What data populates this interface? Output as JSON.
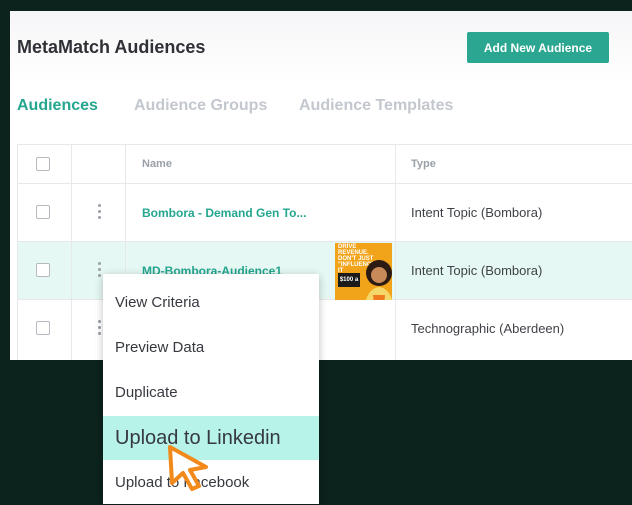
{
  "header": {
    "title": "MetaMatch Audiences",
    "add_button": "Add New Audience"
  },
  "tabs": [
    {
      "label": "Audiences",
      "active": true
    },
    {
      "label": "Audience Groups",
      "active": false
    },
    {
      "label": "Audience Templates",
      "active": false
    }
  ],
  "table": {
    "columns": [
      "Name",
      "Type"
    ],
    "rows": [
      {
        "name": "Bombora - Demand Gen To...",
        "type": "Intent Topic (Bombora)"
      },
      {
        "name": "MD-Bombora-Audience1",
        "type": "Intent Topic (Bombora)",
        "highlighted": true
      },
      {
        "name": "",
        "type": "Technographic (Aberdeen)"
      }
    ]
  },
  "context_menu": {
    "items": [
      {
        "label": "View Criteria"
      },
      {
        "label": "Preview Data"
      },
      {
        "label": "Duplicate"
      },
      {
        "label": "Upload to Linkedin",
        "highlighted": true
      },
      {
        "label": "Upload to Facebook"
      }
    ]
  },
  "ad_thumbnail": {
    "text": "DRIVE REVENUE. DON'T JUST \"INFLUENCE\" IT",
    "badge": "$100 a"
  },
  "colors": {
    "accent": "#2ba791",
    "tab_active": "#25a68f",
    "row_highlight": "#e6f8f3",
    "menu_highlight": "#b7f3e8",
    "cursor": "#f28a1b",
    "background": "#0c221d"
  },
  "icons": {
    "row_menu": "kebab-vertical-icon",
    "pointer": "mouse-pointer-icon"
  }
}
